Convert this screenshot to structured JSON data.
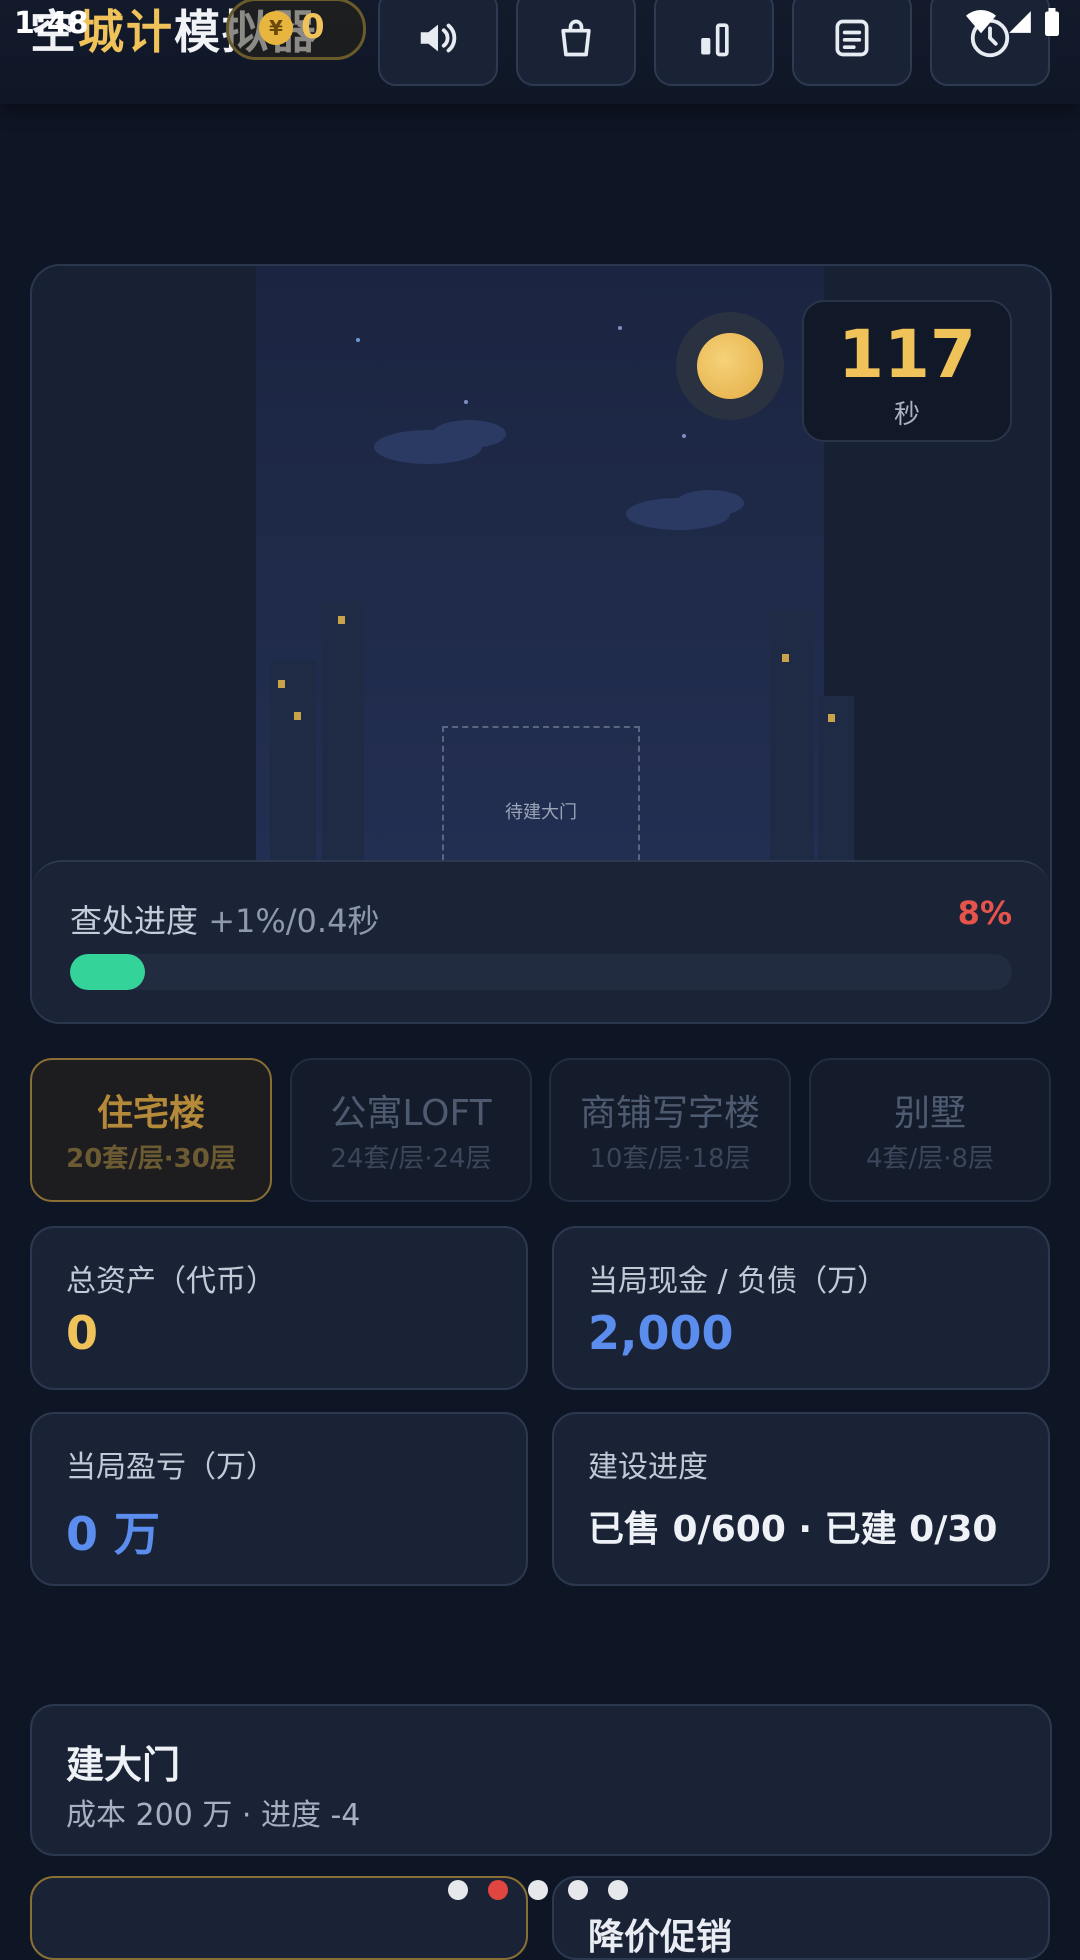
{
  "status_bar": {
    "time": "1:48",
    "wifi_icon": "wifi-icon",
    "signal_icon": "signal-icon",
    "battery_icon": "battery-icon"
  },
  "header": {
    "title_part1": "空",
    "title_part2": "城计",
    "title_part3": "模拟器",
    "coin_symbol": "¥",
    "coin_value": "0",
    "buttons": [
      {
        "icon": "sound-icon"
      },
      {
        "icon": "shop-bag-icon"
      },
      {
        "icon": "leaderboard-icon"
      },
      {
        "icon": "notes-icon"
      },
      {
        "icon": "history-icon"
      }
    ]
  },
  "scene": {
    "gate_placeholder": "待建大门",
    "timer_value": "117",
    "timer_unit": "秒"
  },
  "progress": {
    "label": "查处进度",
    "rate": "+1%/0.4秒",
    "percent_text": "8%",
    "percent_value": 8
  },
  "tabs": [
    {
      "name": "住宅楼",
      "sub": "20套/层·30层",
      "active": true
    },
    {
      "name": "公寓LOFT",
      "sub": "24套/层·24层",
      "active": false
    },
    {
      "name": "商铺写字楼",
      "sub": "10套/层·18层",
      "active": false
    },
    {
      "name": "别墅",
      "sub": "4套/层·8层",
      "active": false
    }
  ],
  "stats": {
    "total_assets_label": "总资产（代币）",
    "total_assets_value": "0",
    "cash_label": "当局现金 / 负债（万）",
    "cash_value": "2,000",
    "profit_label": "当局盈亏（万）",
    "profit_value": "0 万",
    "build_label": "建设进度",
    "build_value": "已售 0/600 · 已建 0/30"
  },
  "action": {
    "title": "建大门",
    "desc": "成本 200 万 · 进度 -4"
  },
  "bottom_cards": [
    {
      "title": ""
    },
    {
      "title": "降价促销"
    }
  ],
  "pager": {
    "count": 5,
    "active_index": 1
  },
  "colors": {
    "accent_gold": "#f0c25a",
    "accent_blue": "#5b8def",
    "progress_green": "#34d399",
    "alert_red": "#e5534b"
  }
}
